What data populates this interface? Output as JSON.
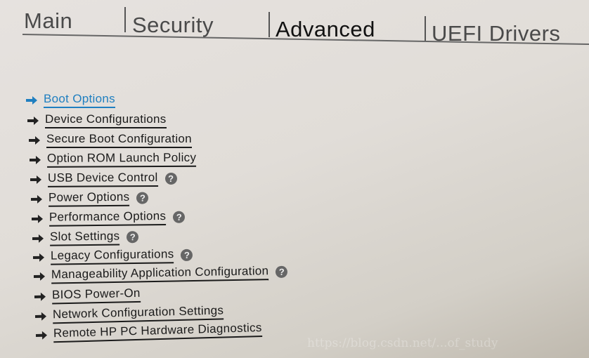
{
  "tabs": [
    {
      "label": "Main",
      "active": false
    },
    {
      "label": "Security",
      "active": false
    },
    {
      "label": "Advanced",
      "active": true
    },
    {
      "label": "UEFI Drivers",
      "active": false
    }
  ],
  "menu": {
    "selected_color": "#1f7fc0",
    "items": [
      {
        "label": "Boot Options",
        "help": false,
        "selected": true
      },
      {
        "label": "Device Configurations",
        "help": false
      },
      {
        "label": "Secure Boot Configuration",
        "help": false
      },
      {
        "label": "Option ROM Launch Policy",
        "help": false
      },
      {
        "label": "USB Device Control",
        "help": true
      },
      {
        "label": "Power Options",
        "help": true
      },
      {
        "label": "Performance Options",
        "help": true
      },
      {
        "label": "Slot Settings",
        "help": true
      },
      {
        "label": "Legacy Configurations",
        "help": true
      },
      {
        "label": "Manageability Application Configuration",
        "help": true
      },
      {
        "label": "BIOS Power-On",
        "help": false
      },
      {
        "label": "Network Configuration Settings",
        "help": false
      },
      {
        "label": "Remote HP PC Hardware Diagnostics",
        "help": false
      }
    ],
    "help_icon": "question-circle-icon",
    "help_glyph": "?"
  },
  "watermark": "https://blog.csdn.net/...of_study"
}
